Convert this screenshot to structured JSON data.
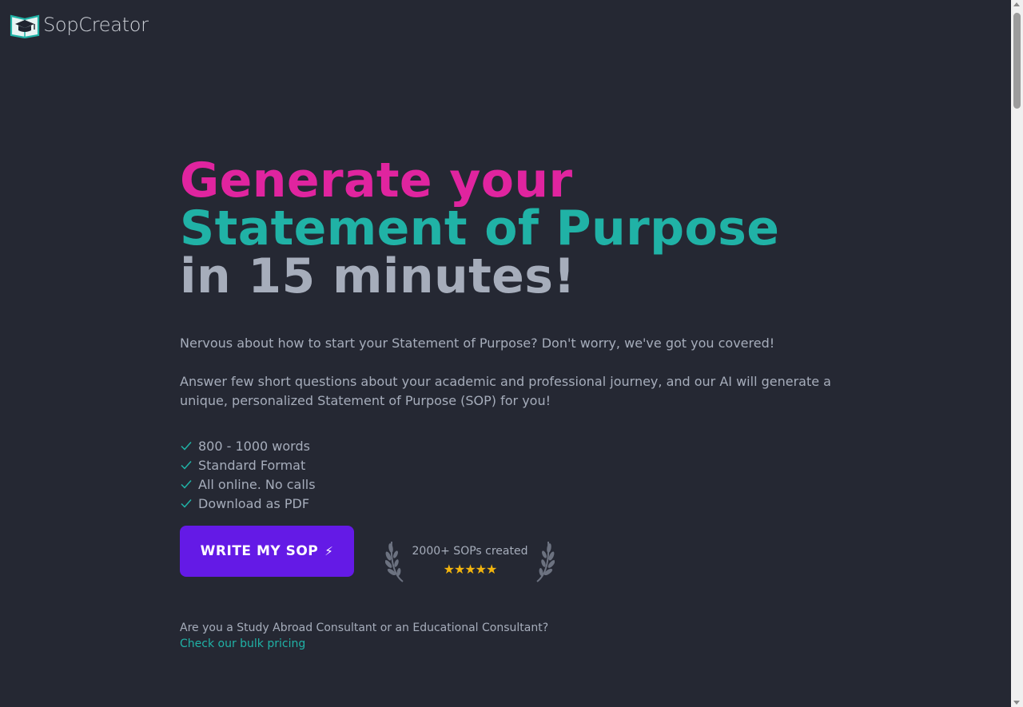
{
  "header": {
    "brand": "SopCreator",
    "logo_icon": "graduation-cap-book-icon"
  },
  "hero": {
    "headline_line1": "Generate your",
    "headline_line2": "Statement of Purpose",
    "headline_line3": "in 15 minutes!",
    "paragraph1": "Nervous about how to start your Statement of Purpose? Don't worry, we've got you covered!",
    "paragraph2": "Answer few short questions about your academic and professional journey, and our AI will generate a unique, personalized Statement of Purpose (SOP) for you!"
  },
  "features": [
    {
      "label": "800 - 1000 words",
      "icon": "check-icon"
    },
    {
      "label": "Standard Format",
      "icon": "check-icon"
    },
    {
      "label": "All online. No calls",
      "icon": "check-icon"
    },
    {
      "label": "Download as PDF",
      "icon": "check-icon"
    }
  ],
  "cta": {
    "label": "WRITE MY SOP",
    "icon_glyph": "⚡"
  },
  "badge": {
    "text": "2000+ SOPs created",
    "stars": "★★★★★",
    "rating": 5
  },
  "consultant": {
    "question": "Are you a Study Abroad Consultant or an Educational Consultant?",
    "link": "Check our bulk pricing"
  },
  "colors": {
    "background": "#252833",
    "accent_pink": "#e0249f",
    "accent_teal": "#20b2a6",
    "primary_button": "#641ae6",
    "star": "#f3b50e"
  }
}
